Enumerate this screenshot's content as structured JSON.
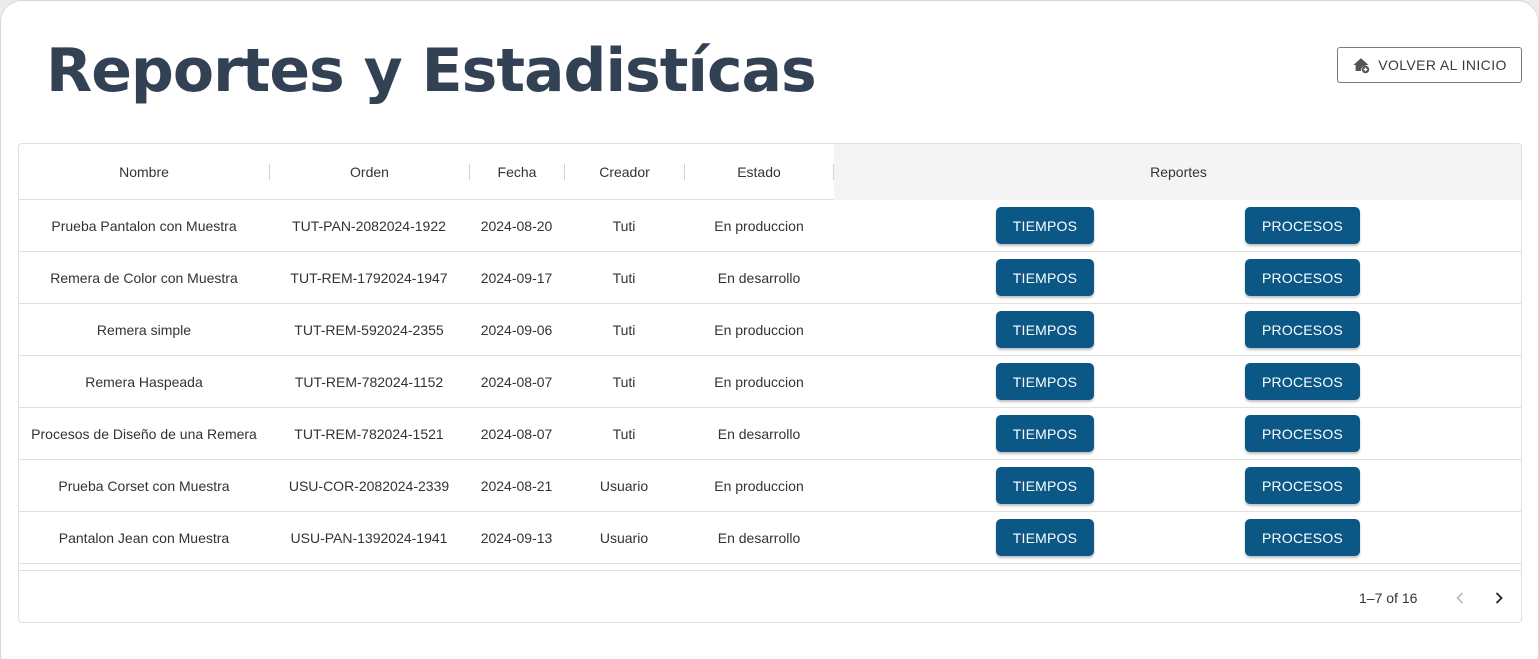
{
  "page": {
    "title": "Reportes y Estadistícas",
    "home_button": {
      "label": "VOLVER AL INICIO",
      "icon": "home-add-icon"
    }
  },
  "table": {
    "columns": [
      "Nombre",
      "Orden",
      "Fecha",
      "Creador",
      "Estado",
      "Reportes"
    ],
    "rows": [
      {
        "nombre": "Prueba Pantalon con Muestra",
        "orden": "TUT-PAN-2082024-1922",
        "fecha": "2024-08-20",
        "creador": "Tuti",
        "estado": "En produccion"
      },
      {
        "nombre": "Remera de Color con Muestra",
        "orden": "TUT-REM-1792024-1947",
        "fecha": "2024-09-17",
        "creador": "Tuti",
        "estado": "En desarrollo"
      },
      {
        "nombre": "Remera simple",
        "orden": "TUT-REM-592024-2355",
        "fecha": "2024-09-06",
        "creador": "Tuti",
        "estado": "En produccion"
      },
      {
        "nombre": "Remera Haspeada",
        "orden": "TUT-REM-782024-1152",
        "fecha": "2024-08-07",
        "creador": "Tuti",
        "estado": "En produccion"
      },
      {
        "nombre": "Procesos de Diseño de una Remera",
        "orden": "TUT-REM-782024-1521",
        "fecha": "2024-08-07",
        "creador": "Tuti",
        "estado": "En desarrollo"
      },
      {
        "nombre": "Prueba Corset con Muestra",
        "orden": "USU-COR-2082024-2339",
        "fecha": "2024-08-21",
        "creador": "Usuario",
        "estado": "En produccion"
      },
      {
        "nombre": "Pantalon Jean con Muestra",
        "orden": "USU-PAN-1392024-1941",
        "fecha": "2024-09-13",
        "creador": "Usuario",
        "estado": "En desarrollo"
      }
    ],
    "actions": {
      "tiempos_label": "TIEMPOS",
      "procesos_label": "PROCESOS"
    },
    "pagination": {
      "range_text": "1–7 of 16",
      "prev_icon": "chevron-left-icon",
      "next_icon": "chevron-right-icon"
    }
  },
  "colors": {
    "title": "#334155",
    "button_bg": "#0b5786",
    "header_reportes_bg": "#f4f4f4"
  }
}
